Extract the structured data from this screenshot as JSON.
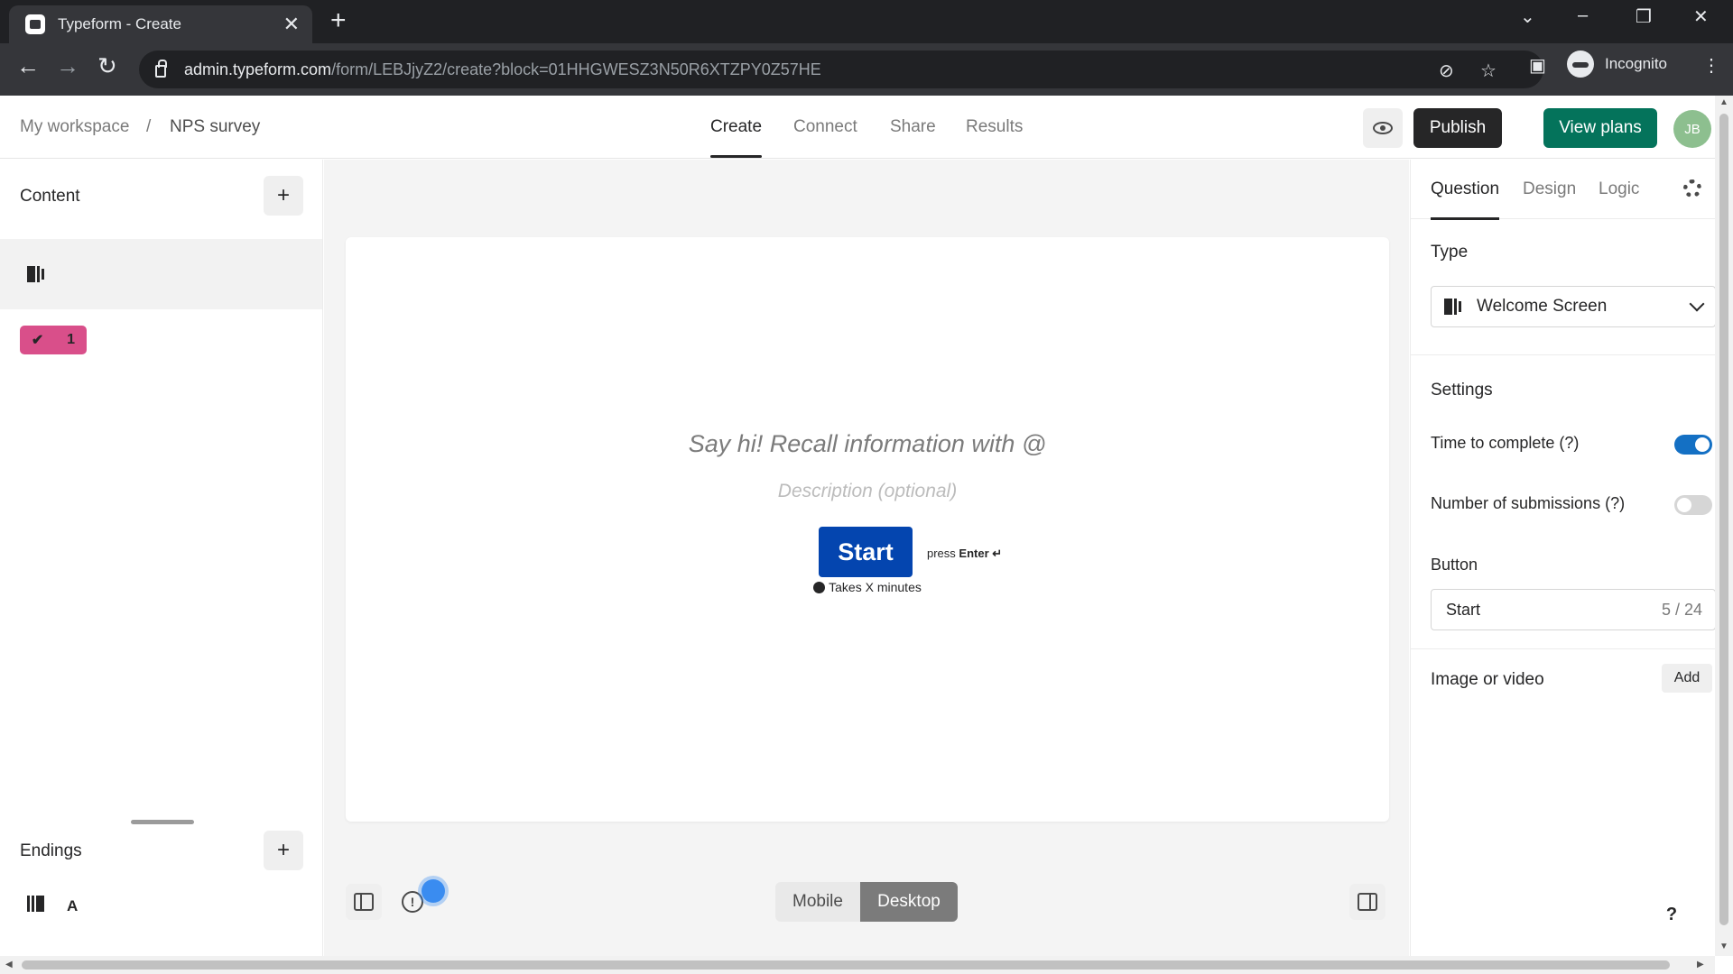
{
  "browser": {
    "tab_title": "Typeform - Create",
    "url_host": "admin.typeform.com",
    "url_path": "/form/LEBJjyZ2/create?block=01HHGWESZ3N50R6XTZPY0Z57HE",
    "profile_label": "Incognito"
  },
  "header": {
    "breadcrumb": [
      "My workspace",
      "/",
      "NPS survey"
    ],
    "tabs": [
      {
        "label": "Create",
        "active": true
      },
      {
        "label": "Connect",
        "active": false
      },
      {
        "label": "Share",
        "active": false
      },
      {
        "label": "Results",
        "active": false
      }
    ],
    "publish_label": "Publish",
    "view_plans_label": "View plans",
    "avatar_initials": "JB"
  },
  "left_panel": {
    "content_title": "Content",
    "add_symbol": "+",
    "question_number": "1",
    "endings_title": "Endings",
    "ending_letter": "A"
  },
  "canvas": {
    "welcome_title": "Say hi! Recall information with @",
    "welcome_description": "Description (optional)",
    "start_label": "Start",
    "press_prefix": "press",
    "press_key": "Enter ↵",
    "takes_text": "Takes X minutes",
    "device_options": [
      "Mobile",
      "Desktop"
    ],
    "selected_device": "Desktop"
  },
  "right_panel": {
    "tabs": [
      {
        "label": "Question",
        "active": true
      },
      {
        "label": "Design",
        "active": false
      },
      {
        "label": "Logic",
        "active": false
      }
    ],
    "type_label": "Type",
    "type_value": "Welcome Screen",
    "settings_label": "Settings",
    "time_to_complete_label": "Time to complete (?)",
    "time_to_complete_on": true,
    "submissions_label": "Number of submissions (?)",
    "submissions_on": false,
    "button_label": "Button",
    "button_value": "Start",
    "button_counter": "5 / 24",
    "media_label": "Image or video",
    "media_add_label": "Add"
  },
  "help_label": "?",
  "colors": {
    "brand_green": "#04735b",
    "start_blue": "#0445af",
    "question_badge": "#d94f8a",
    "toggle_on": "#1470c4"
  }
}
